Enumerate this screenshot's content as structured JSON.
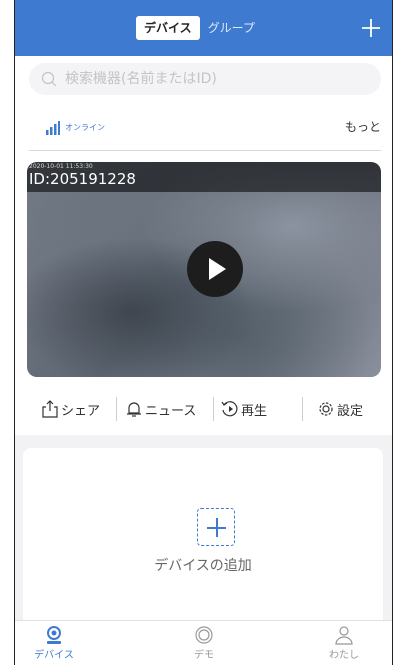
{
  "header": {
    "tabs": [
      {
        "label": "デバイス",
        "active": true
      },
      {
        "label": "グループ",
        "active": false
      }
    ],
    "add_icon": "plus-icon"
  },
  "search": {
    "placeholder": "検索機器(名前またはID)",
    "icon": "search-icon"
  },
  "status": {
    "online_label": "オンライン",
    "more_label": "もっと",
    "signal_icon": "signal-bars-icon"
  },
  "camera": {
    "timestamp": "2020-10-01 11:53:30",
    "device_id": "ID:205191228",
    "play_icon": "play-icon"
  },
  "actions": [
    {
      "label": "シェア",
      "icon": "share-icon"
    },
    {
      "label": "ニュース",
      "icon": "bell-icon"
    },
    {
      "label": "再生",
      "icon": "replay-icon"
    },
    {
      "label": "設定",
      "icon": "gear-icon"
    }
  ],
  "add_device": {
    "label": "デバイスの追加",
    "icon": "add-dashed-icon"
  },
  "bottom_nav": [
    {
      "label": "デバイス",
      "icon": "camera-icon",
      "active": true
    },
    {
      "label": "デモ",
      "icon": "demo-icon",
      "active": false
    },
    {
      "label": "わたし",
      "icon": "user-icon",
      "active": false
    }
  ],
  "colors": {
    "accent": "#3e7bd0",
    "background": "#ffffff",
    "muted": "#f2f2f4"
  }
}
